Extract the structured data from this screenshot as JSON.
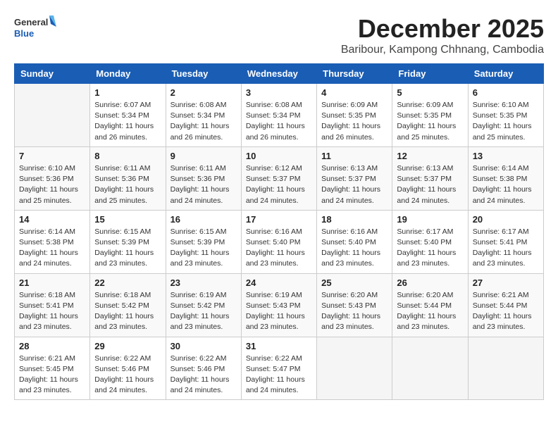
{
  "logo": {
    "general": "General",
    "blue": "Blue"
  },
  "title": "December 2025",
  "location": "Baribour, Kampong Chhnang, Cambodia",
  "days_header": [
    "Sunday",
    "Monday",
    "Tuesday",
    "Wednesday",
    "Thursday",
    "Friday",
    "Saturday"
  ],
  "weeks": [
    [
      {
        "day": "",
        "info": ""
      },
      {
        "day": "1",
        "info": "Sunrise: 6:07 AM\nSunset: 5:34 PM\nDaylight: 11 hours\nand 26 minutes."
      },
      {
        "day": "2",
        "info": "Sunrise: 6:08 AM\nSunset: 5:34 PM\nDaylight: 11 hours\nand 26 minutes."
      },
      {
        "day": "3",
        "info": "Sunrise: 6:08 AM\nSunset: 5:34 PM\nDaylight: 11 hours\nand 26 minutes."
      },
      {
        "day": "4",
        "info": "Sunrise: 6:09 AM\nSunset: 5:35 PM\nDaylight: 11 hours\nand 26 minutes."
      },
      {
        "day": "5",
        "info": "Sunrise: 6:09 AM\nSunset: 5:35 PM\nDaylight: 11 hours\nand 25 minutes."
      },
      {
        "day": "6",
        "info": "Sunrise: 6:10 AM\nSunset: 5:35 PM\nDaylight: 11 hours\nand 25 minutes."
      }
    ],
    [
      {
        "day": "7",
        "info": "Sunrise: 6:10 AM\nSunset: 5:36 PM\nDaylight: 11 hours\nand 25 minutes."
      },
      {
        "day": "8",
        "info": "Sunrise: 6:11 AM\nSunset: 5:36 PM\nDaylight: 11 hours\nand 25 minutes."
      },
      {
        "day": "9",
        "info": "Sunrise: 6:11 AM\nSunset: 5:36 PM\nDaylight: 11 hours\nand 24 minutes."
      },
      {
        "day": "10",
        "info": "Sunrise: 6:12 AM\nSunset: 5:37 PM\nDaylight: 11 hours\nand 24 minutes."
      },
      {
        "day": "11",
        "info": "Sunrise: 6:13 AM\nSunset: 5:37 PM\nDaylight: 11 hours\nand 24 minutes."
      },
      {
        "day": "12",
        "info": "Sunrise: 6:13 AM\nSunset: 5:37 PM\nDaylight: 11 hours\nand 24 minutes."
      },
      {
        "day": "13",
        "info": "Sunrise: 6:14 AM\nSunset: 5:38 PM\nDaylight: 11 hours\nand 24 minutes."
      }
    ],
    [
      {
        "day": "14",
        "info": "Sunrise: 6:14 AM\nSunset: 5:38 PM\nDaylight: 11 hours\nand 24 minutes."
      },
      {
        "day": "15",
        "info": "Sunrise: 6:15 AM\nSunset: 5:39 PM\nDaylight: 11 hours\nand 23 minutes."
      },
      {
        "day": "16",
        "info": "Sunrise: 6:15 AM\nSunset: 5:39 PM\nDaylight: 11 hours\nand 23 minutes."
      },
      {
        "day": "17",
        "info": "Sunrise: 6:16 AM\nSunset: 5:40 PM\nDaylight: 11 hours\nand 23 minutes."
      },
      {
        "day": "18",
        "info": "Sunrise: 6:16 AM\nSunset: 5:40 PM\nDaylight: 11 hours\nand 23 minutes."
      },
      {
        "day": "19",
        "info": "Sunrise: 6:17 AM\nSunset: 5:40 PM\nDaylight: 11 hours\nand 23 minutes."
      },
      {
        "day": "20",
        "info": "Sunrise: 6:17 AM\nSunset: 5:41 PM\nDaylight: 11 hours\nand 23 minutes."
      }
    ],
    [
      {
        "day": "21",
        "info": "Sunrise: 6:18 AM\nSunset: 5:41 PM\nDaylight: 11 hours\nand 23 minutes."
      },
      {
        "day": "22",
        "info": "Sunrise: 6:18 AM\nSunset: 5:42 PM\nDaylight: 11 hours\nand 23 minutes."
      },
      {
        "day": "23",
        "info": "Sunrise: 6:19 AM\nSunset: 5:42 PM\nDaylight: 11 hours\nand 23 minutes."
      },
      {
        "day": "24",
        "info": "Sunrise: 6:19 AM\nSunset: 5:43 PM\nDaylight: 11 hours\nand 23 minutes."
      },
      {
        "day": "25",
        "info": "Sunrise: 6:20 AM\nSunset: 5:43 PM\nDaylight: 11 hours\nand 23 minutes."
      },
      {
        "day": "26",
        "info": "Sunrise: 6:20 AM\nSunset: 5:44 PM\nDaylight: 11 hours\nand 23 minutes."
      },
      {
        "day": "27",
        "info": "Sunrise: 6:21 AM\nSunset: 5:44 PM\nDaylight: 11 hours\nand 23 minutes."
      }
    ],
    [
      {
        "day": "28",
        "info": "Sunrise: 6:21 AM\nSunset: 5:45 PM\nDaylight: 11 hours\nand 23 minutes."
      },
      {
        "day": "29",
        "info": "Sunrise: 6:22 AM\nSunset: 5:46 PM\nDaylight: 11 hours\nand 24 minutes."
      },
      {
        "day": "30",
        "info": "Sunrise: 6:22 AM\nSunset: 5:46 PM\nDaylight: 11 hours\nand 24 minutes."
      },
      {
        "day": "31",
        "info": "Sunrise: 6:22 AM\nSunset: 5:47 PM\nDaylight: 11 hours\nand 24 minutes."
      },
      {
        "day": "",
        "info": ""
      },
      {
        "day": "",
        "info": ""
      },
      {
        "day": "",
        "info": ""
      }
    ]
  ]
}
